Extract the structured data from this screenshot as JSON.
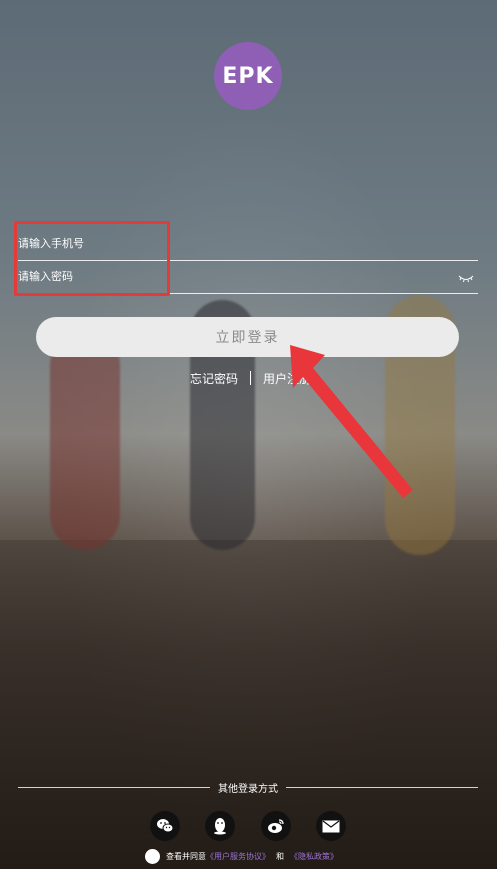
{
  "logo": {
    "text": "EPK"
  },
  "form": {
    "phone_placeholder": "请输入手机号",
    "password_placeholder": "请输入密码",
    "login_label": "立即登录"
  },
  "links": {
    "forgot_password": "忘记密码",
    "register": "用户注册"
  },
  "other_login": {
    "title": "其他登录方式",
    "methods": [
      "wechat-icon",
      "qq-icon",
      "weibo-icon",
      "mail-icon"
    ]
  },
  "agreement": {
    "prefix": "查看并同意",
    "user_agreement": "《用户服务协议》",
    "and": "和",
    "privacy_policy": "《隐私政策》"
  },
  "colors": {
    "brand": "#8e5fb4",
    "highlight": "#e53a3a",
    "link": "#9d73d4"
  }
}
